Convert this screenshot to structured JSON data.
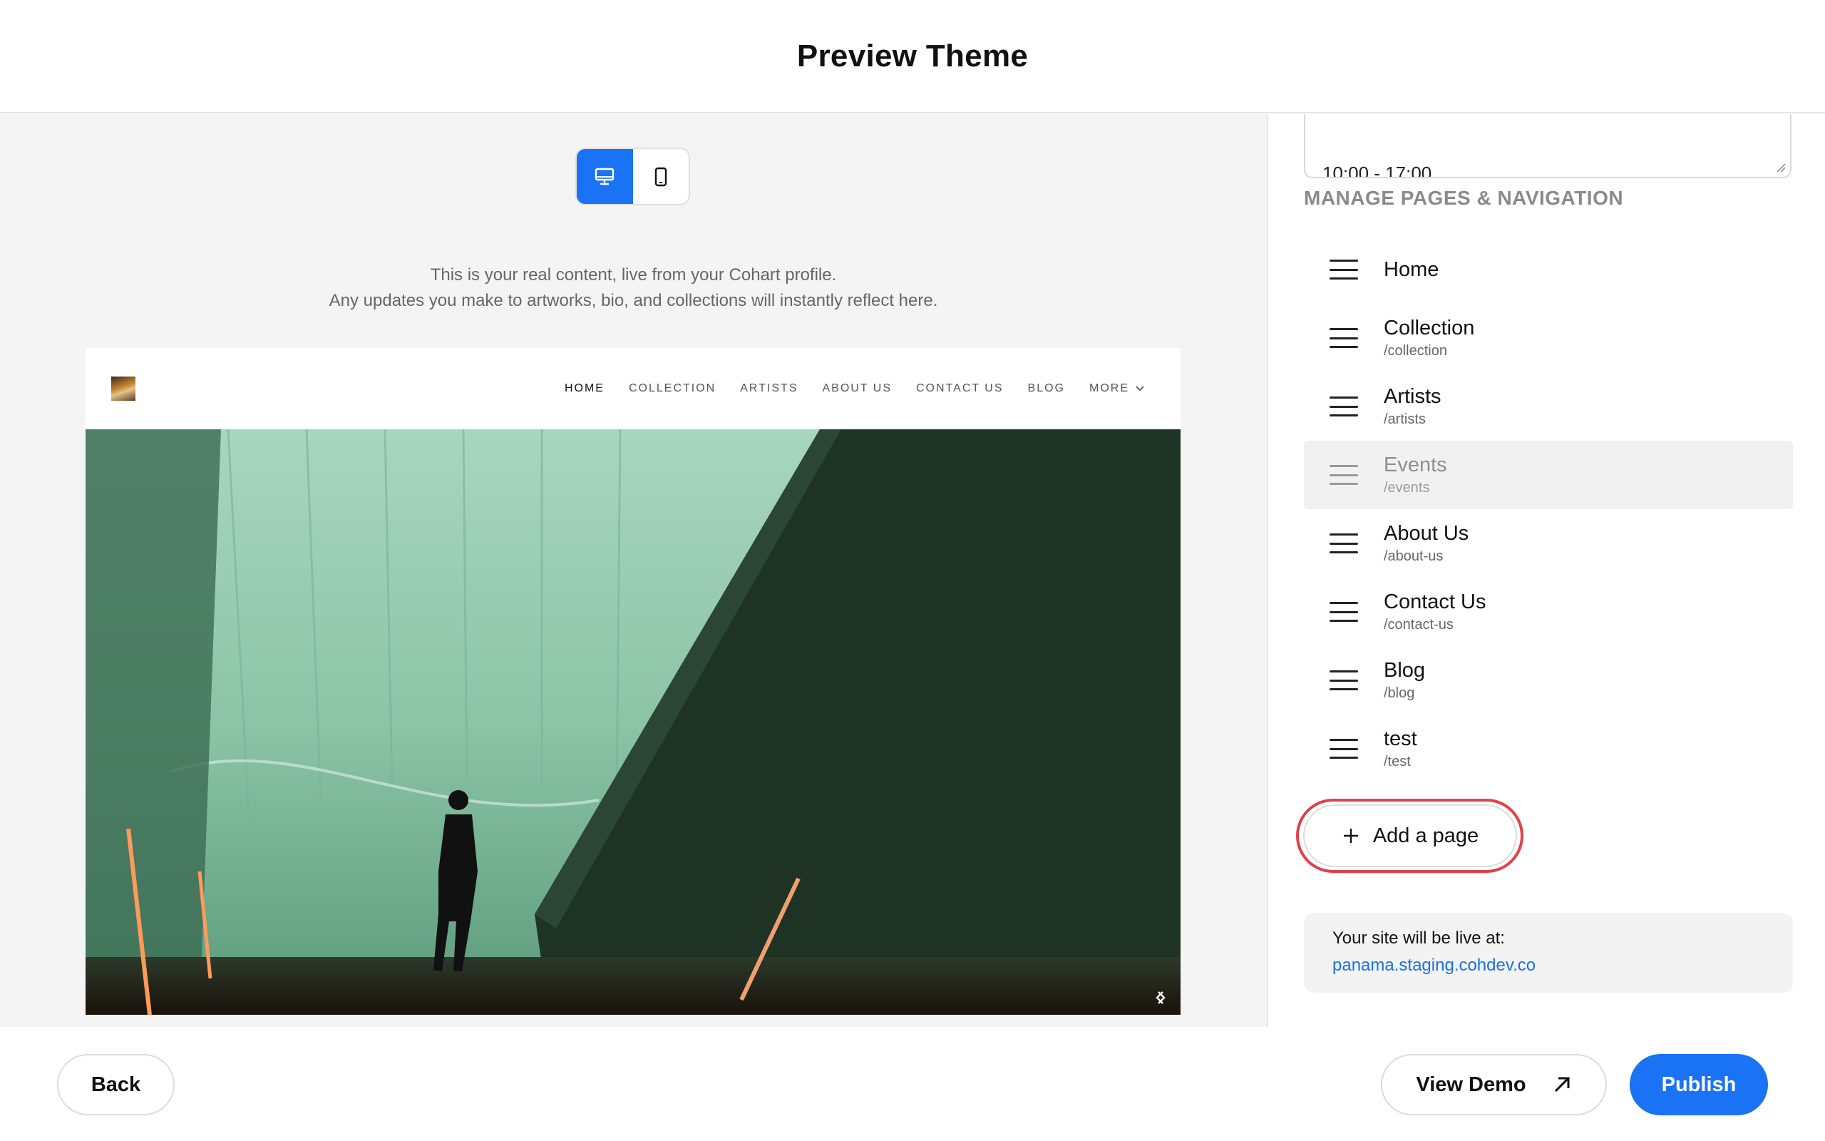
{
  "header": {
    "title": "Preview Theme"
  },
  "device_toggle": {
    "selected": "desktop",
    "options": [
      "desktop-icon",
      "mobile-icon"
    ]
  },
  "intro": {
    "line1": "This is your real content, live from your Cohart profile.",
    "line2": "Any updates you make to artworks, bio, and collections will instantly reflect here."
  },
  "site_preview": {
    "menu": [
      {
        "label": "HOME",
        "active": true
      },
      {
        "label": "COLLECTION",
        "active": false
      },
      {
        "label": "ARTISTS",
        "active": false
      },
      {
        "label": "ABOUT US",
        "active": false
      },
      {
        "label": "CONTACT US",
        "active": false
      },
      {
        "label": "BLOG",
        "active": false
      },
      {
        "label": "MORE",
        "active": false
      }
    ]
  },
  "sidebar": {
    "hours_text": "10:00 - 17:00",
    "section_title": "MANAGE PAGES & NAVIGATION",
    "pages": [
      {
        "name": "Home",
        "slug": "",
        "dimmed": false
      },
      {
        "name": "Collection",
        "slug": "/collection",
        "dimmed": false
      },
      {
        "name": "Artists",
        "slug": "/artists",
        "dimmed": false
      },
      {
        "name": "Events",
        "slug": "/events",
        "dimmed": true
      },
      {
        "name": "About Us",
        "slug": "/about-us",
        "dimmed": false
      },
      {
        "name": "Contact Us",
        "slug": "/contact-us",
        "dimmed": false
      },
      {
        "name": "Blog",
        "slug": "/blog",
        "dimmed": false
      },
      {
        "name": "test",
        "slug": "/test",
        "dimmed": false
      }
    ],
    "add_page_label": "Add a page",
    "live_label": "Your site will be live at:",
    "live_url": "panama.staging.cohdev.co"
  },
  "footer": {
    "back_label": "Back",
    "view_demo_label": "View Demo",
    "publish_label": "Publish"
  },
  "colors": {
    "accent": "#1a73f5",
    "highlight": "#e0404b",
    "link": "#1a6fe8"
  }
}
